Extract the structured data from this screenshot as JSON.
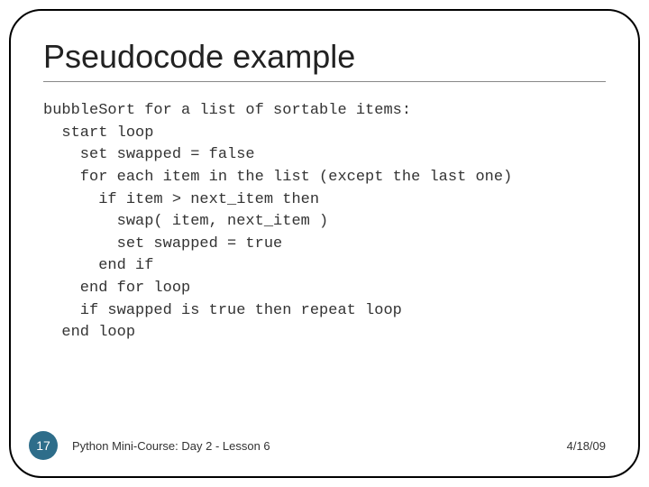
{
  "slide": {
    "title": "Pseudocode example",
    "code": "bubbleSort for a list of sortable items:\n  start loop\n    set swapped = false\n    for each item in the list (except the last one)\n      if item > next_item then\n        swap( item, next_item )\n        set swapped = true\n      end if\n    end for loop\n    if swapped is true then repeat loop\n  end loop"
  },
  "footer": {
    "page_number": "17",
    "course_label": "Python Mini-Course: Day 2 - Lesson 6",
    "date": "4/18/09"
  }
}
